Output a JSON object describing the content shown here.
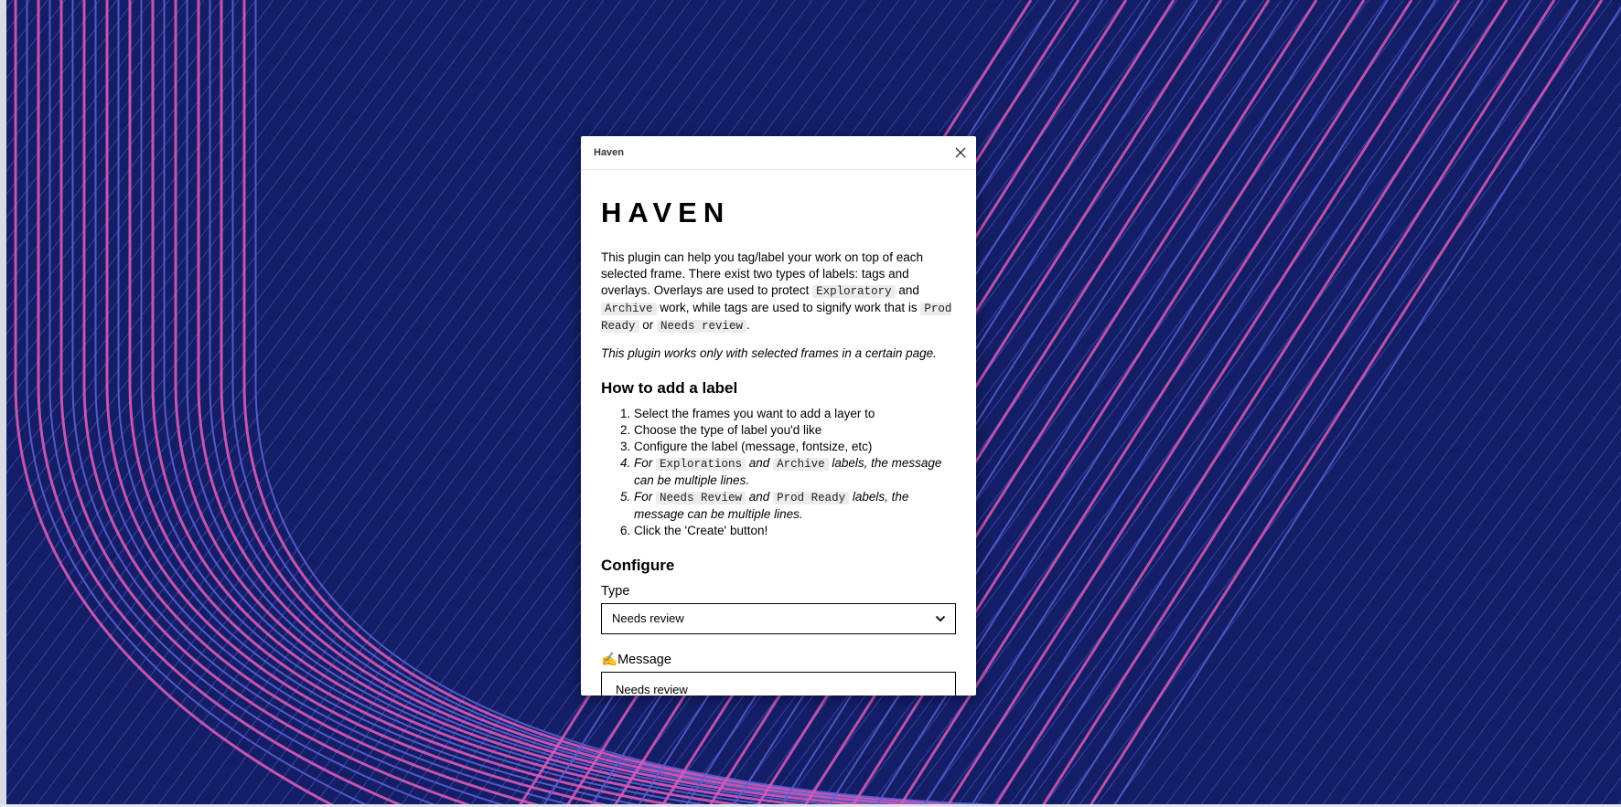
{
  "colors": {
    "canvas_background": "#131e66",
    "line_blue": "#5b5fd0",
    "line_pink": "#d95ab8",
    "remove_red": "#e53935"
  },
  "window": {
    "title": "Haven",
    "close_icon": "close-icon"
  },
  "content": {
    "brand": "HAVEN",
    "intro": {
      "t1": "This plugin can help you tag/label your work on top of each selected frame. There exist two types of labels: tags and overlays. Overlays are used to protect ",
      "c1": "Exploratory",
      "t2": " and ",
      "c2": "Archive",
      "t3": " work, while tags are used to signify work that is ",
      "c3": "Prod Ready",
      "t4": " or ",
      "c4": "Needs review",
      "t5": "."
    },
    "note": "This plugin works only with selected frames in a certain page.",
    "how_heading": "How to add a label",
    "steps": {
      "s1": "Select the frames you want to add a layer to",
      "s2": "Choose the type of label you'd like",
      "s3": "Configure the label (message, fontsize, etc)",
      "s4": {
        "a": "For ",
        "c1": "Explorations",
        "b": " and ",
        "c2": "Archive",
        "d": " labels, the message can be multiple lines."
      },
      "s5": {
        "a": "For ",
        "c1": "Needs Review",
        "b": " and ",
        "c2": "Prod Ready",
        "d": " labels, the message can be multiple lines."
      },
      "s6": "Click the 'Create' button!"
    },
    "configure_heading": "Configure",
    "type_label": "Type",
    "type_value": "Needs review",
    "message_emoji": "✍️",
    "message_label": "Message",
    "message_value": "Needs review",
    "buttons": {
      "create": "",
      "remove": ""
    }
  }
}
